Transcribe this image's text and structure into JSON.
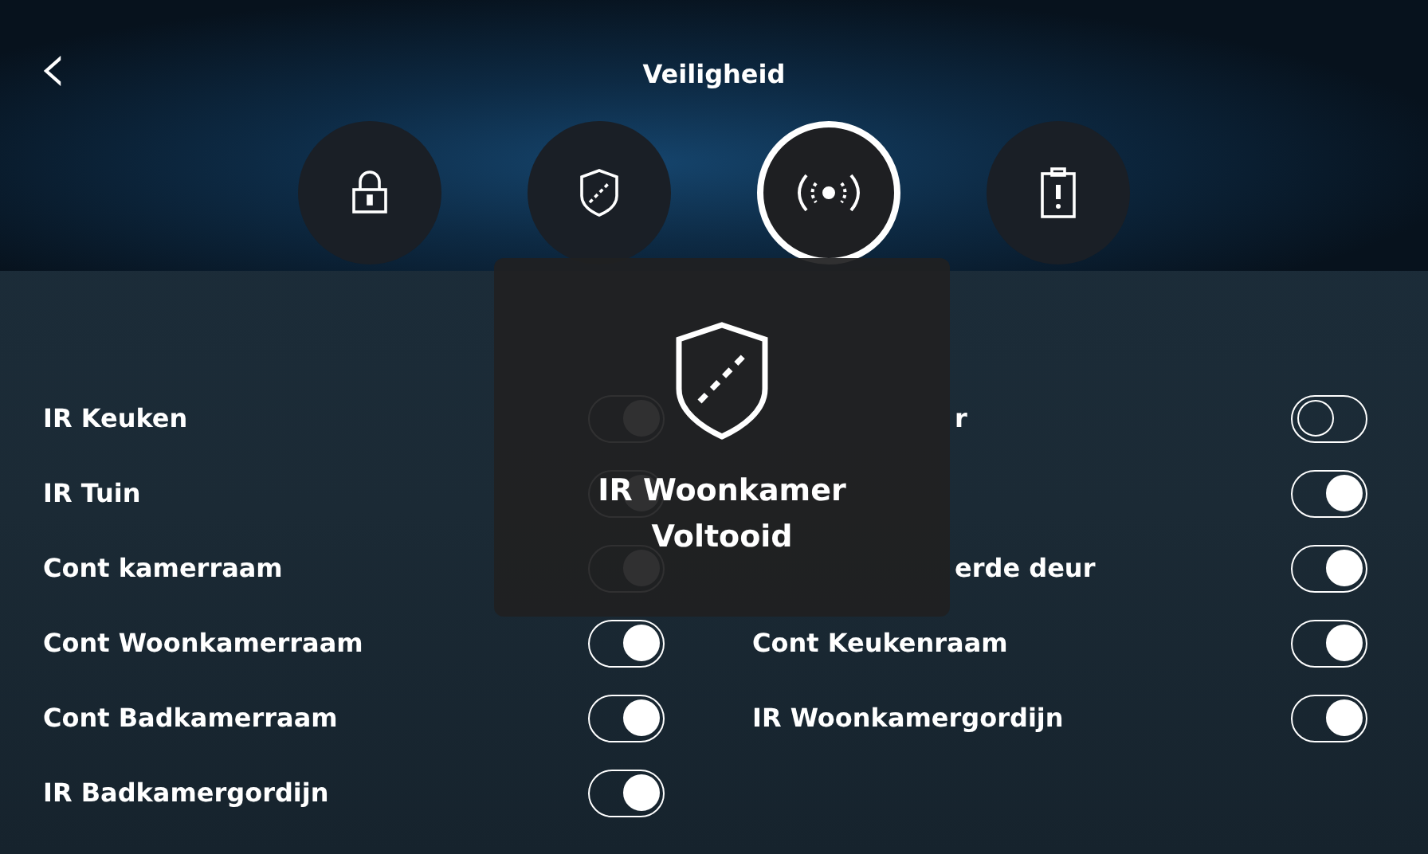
{
  "header": {
    "back_icon": "‹",
    "title": "Veiligheid"
  },
  "tabs": [
    {
      "kind": "lock",
      "selected": false
    },
    {
      "kind": "shield",
      "selected": false
    },
    {
      "kind": "sensor",
      "selected": true
    },
    {
      "kind": "clipboard",
      "selected": false
    }
  ],
  "zones_left": [
    {
      "label": "IR Keuken",
      "on": true
    },
    {
      "label": "IR Tuin",
      "on": true
    },
    {
      "label": "Cont kamerraam",
      "on": true
    },
    {
      "label": "Cont Woonkamerraam",
      "on": true
    },
    {
      "label": "Cont Badkamerraam",
      "on": true
    },
    {
      "label": "IR Badkamergordijn",
      "on": true
    }
  ],
  "zones_right": [
    {
      "label": "r",
      "covered": true,
      "on": false
    },
    {
      "on": true
    },
    {
      "label": "erde deur",
      "covered": true,
      "on": true
    },
    {
      "label": "Cont Keukenraam",
      "covered": false,
      "on": true
    },
    {
      "label": "IR Woonkamergordijn",
      "covered": false,
      "on": true
    }
  ],
  "toast": {
    "line_1": "IR Woonkamer",
    "line_2": "Voltooid"
  }
}
